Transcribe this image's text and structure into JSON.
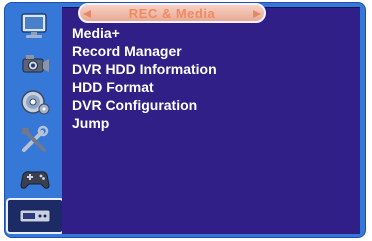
{
  "header": {
    "title": "REC & Media"
  },
  "sidebar": {
    "items": [
      {
        "icon": "display-icon",
        "selected": false
      },
      {
        "icon": "camera-icon",
        "selected": false
      },
      {
        "icon": "disc-icon",
        "selected": false
      },
      {
        "icon": "tools-icon",
        "selected": false
      },
      {
        "icon": "gamepad-icon",
        "selected": false
      },
      {
        "icon": "dvr-icon",
        "selected": true
      }
    ]
  },
  "menu": {
    "items": [
      "Media+",
      "Record Manager",
      "DVR HDD Information",
      "HDD Format",
      "DVR Configuration",
      "Jump"
    ]
  },
  "colors": {
    "frame": "#3578d8",
    "panel": "#2f1f86",
    "title_text": "#ef8b64",
    "menu_text": "#ffffff"
  }
}
